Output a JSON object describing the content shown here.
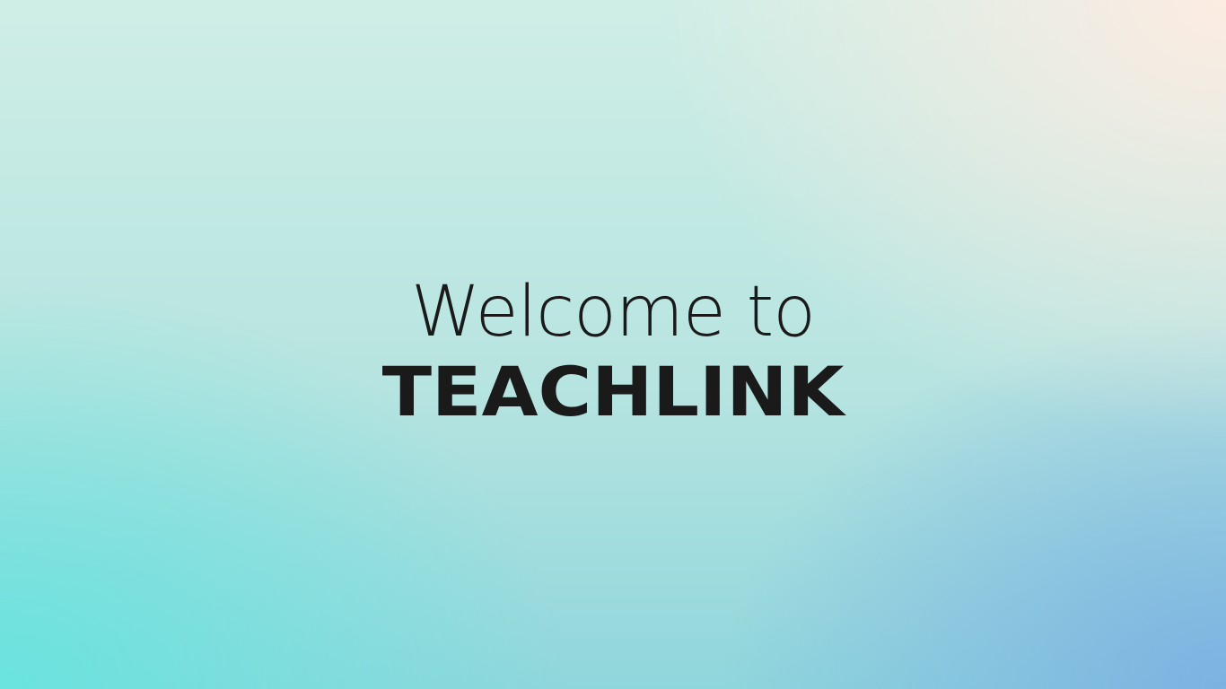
{
  "welcome": {
    "line1": "Welcome to",
    "line2": "TEACHLINK"
  },
  "colors": {
    "text": "#1a1a1a",
    "gradient_top_left": "#cfeee6",
    "gradient_top_right": "#ffece2",
    "gradient_bottom_left": "#68e4de",
    "gradient_bottom_right": "#7ab0e2"
  }
}
